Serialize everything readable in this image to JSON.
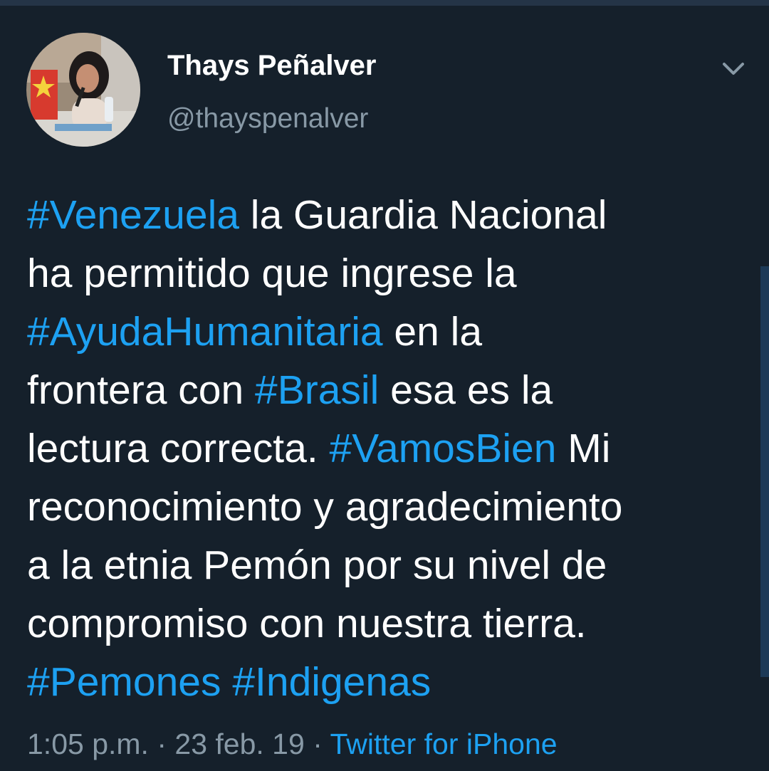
{
  "author": {
    "display_name": "Thays Peñalver",
    "handle": "@thayspenalver"
  },
  "tweet": {
    "lines": [
      [
        {
          "t": "#Venezuela",
          "tag": true
        },
        {
          "t": " la Guardia Nacional",
          "tag": false
        }
      ],
      [
        {
          "t": "ha permitido que ingrese la",
          "tag": false
        }
      ],
      [
        {
          "t": "#AyudaHumanitaria",
          "tag": true
        },
        {
          "t": " en la",
          "tag": false
        }
      ],
      [
        {
          "t": "frontera con ",
          "tag": false
        },
        {
          "t": "#Brasil",
          "tag": true
        },
        {
          "t": " esa es la",
          "tag": false
        }
      ],
      [
        {
          "t": "lectura correcta. ",
          "tag": false
        },
        {
          "t": "#VamosBien",
          "tag": true
        },
        {
          "t": " Mi",
          "tag": false
        }
      ],
      [
        {
          "t": "reconocimiento y agradecimiento",
          "tag": false
        }
      ],
      [
        {
          "t": "a la etnia Pemón por su nivel de",
          "tag": false
        }
      ],
      [
        {
          "t": "compromiso con nuestra tierra.",
          "tag": false
        }
      ],
      [
        {
          "t": "#Pemones",
          "tag": true
        },
        {
          "t": " ",
          "tag": false
        },
        {
          "t": "#Indigenas",
          "tag": true
        }
      ]
    ]
  },
  "meta": {
    "time": "1:05 p.m.",
    "separator": "·",
    "date": "23 feb. 19",
    "source": "Twitter for iPhone"
  },
  "icons": {
    "menu": "chevron-down-icon"
  },
  "colors": {
    "background": "#15202b",
    "text": "#ffffff",
    "secondary_text": "#8899a6",
    "link": "#1da1f2"
  }
}
